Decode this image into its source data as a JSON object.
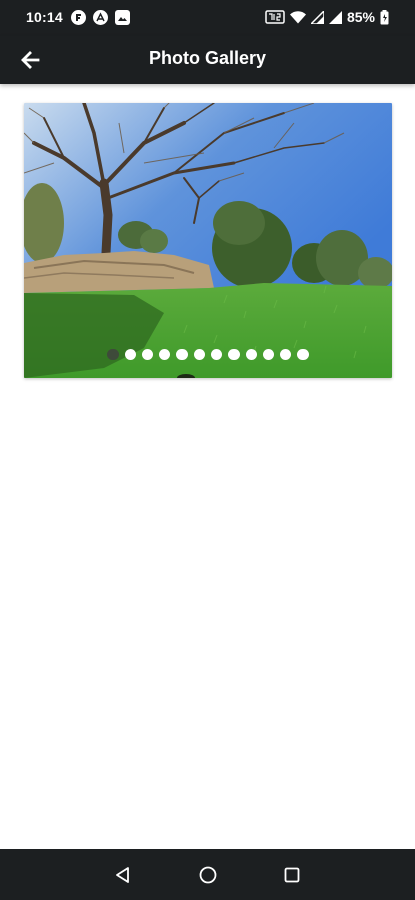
{
  "status_bar": {
    "time": "10:14",
    "battery_percent": "85%",
    "notification_icons": [
      "flipboard-icon",
      "app-store-icon",
      "gallery-icon"
    ],
    "system_icons": [
      "nfc-icon",
      "wifi-icon",
      "signal-icon",
      "signal-icon",
      "battery-icon"
    ]
  },
  "app_bar": {
    "title": "Photo Gallery",
    "back_icon": "arrow-back-icon"
  },
  "gallery": {
    "image_count": 12,
    "current_index": 0
  },
  "nav_bar": {
    "buttons": [
      "back-triangle-icon",
      "home-circle-icon",
      "recents-square-icon"
    ]
  },
  "colors": {
    "bar_background": "#1c1f21",
    "page_background": "#ffffff",
    "active_dot": "#3e4a3a",
    "inactive_dot": "#ffffff"
  }
}
